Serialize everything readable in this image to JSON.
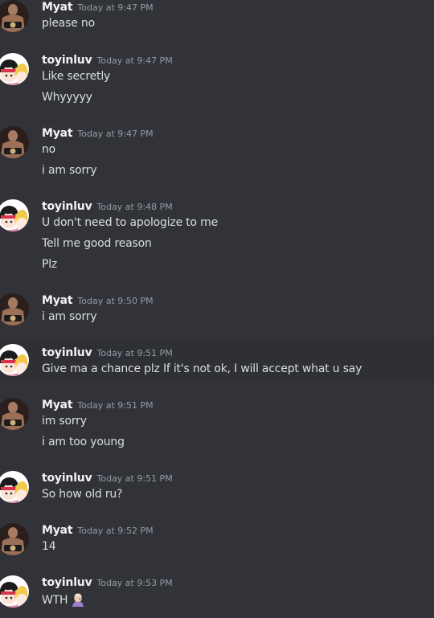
{
  "messages": [
    {
      "user": "Myat",
      "time": "Today at 9:47 PM",
      "avatar": "myat-avatar",
      "lines": [
        "please no"
      ]
    },
    {
      "user": "toyinluv",
      "time": "Today at 9:47 PM",
      "avatar": "toyinluv-avatar",
      "lines": [
        "Like secretly",
        "Whyyyyy"
      ]
    },
    {
      "user": "Myat",
      "time": "Today at 9:47 PM",
      "avatar": "myat-avatar",
      "lines": [
        "no",
        "i am sorry"
      ]
    },
    {
      "user": "toyinluv",
      "time": "Today at 9:48 PM",
      "avatar": "toyinluv-avatar",
      "lines": [
        "U don't need to apologize to me",
        "Tell me good reason",
        "Plz"
      ]
    },
    {
      "user": "Myat",
      "time": "Today at 9:50 PM",
      "avatar": "myat-avatar",
      "lines": [
        "i am sorry"
      ]
    },
    {
      "user": "toyinluv",
      "time": "Today at 9:51 PM",
      "avatar": "toyinluv-avatar",
      "lines": [
        "Give ma a chance plz If it's not ok, I will accept what u say"
      ]
    },
    {
      "user": "Myat",
      "time": "Today at 9:51 PM",
      "avatar": "myat-avatar",
      "lines": [
        "im sorry",
        "i am too young"
      ]
    },
    {
      "user": "toyinluv",
      "time": "Today at 9:51 PM",
      "avatar": "toyinluv-avatar",
      "lines": [
        "So how old ru?"
      ]
    },
    {
      "user": "Myat",
      "time": "Today at 9:52 PM",
      "avatar": "myat-avatar",
      "lines": [
        "14"
      ]
    },
    {
      "user": "toyinluv",
      "time": "Today at 9:53 PM",
      "avatar": "toyinluv-avatar",
      "lines": [
        "WTH"
      ],
      "emoji": "woman-facepalming-emoji"
    }
  ],
  "colors": {
    "background": "#313338",
    "hover_row": "#2e3035",
    "username": "#f2f3f5",
    "timestamp": "#949ba4",
    "text": "#dbdee1"
  }
}
